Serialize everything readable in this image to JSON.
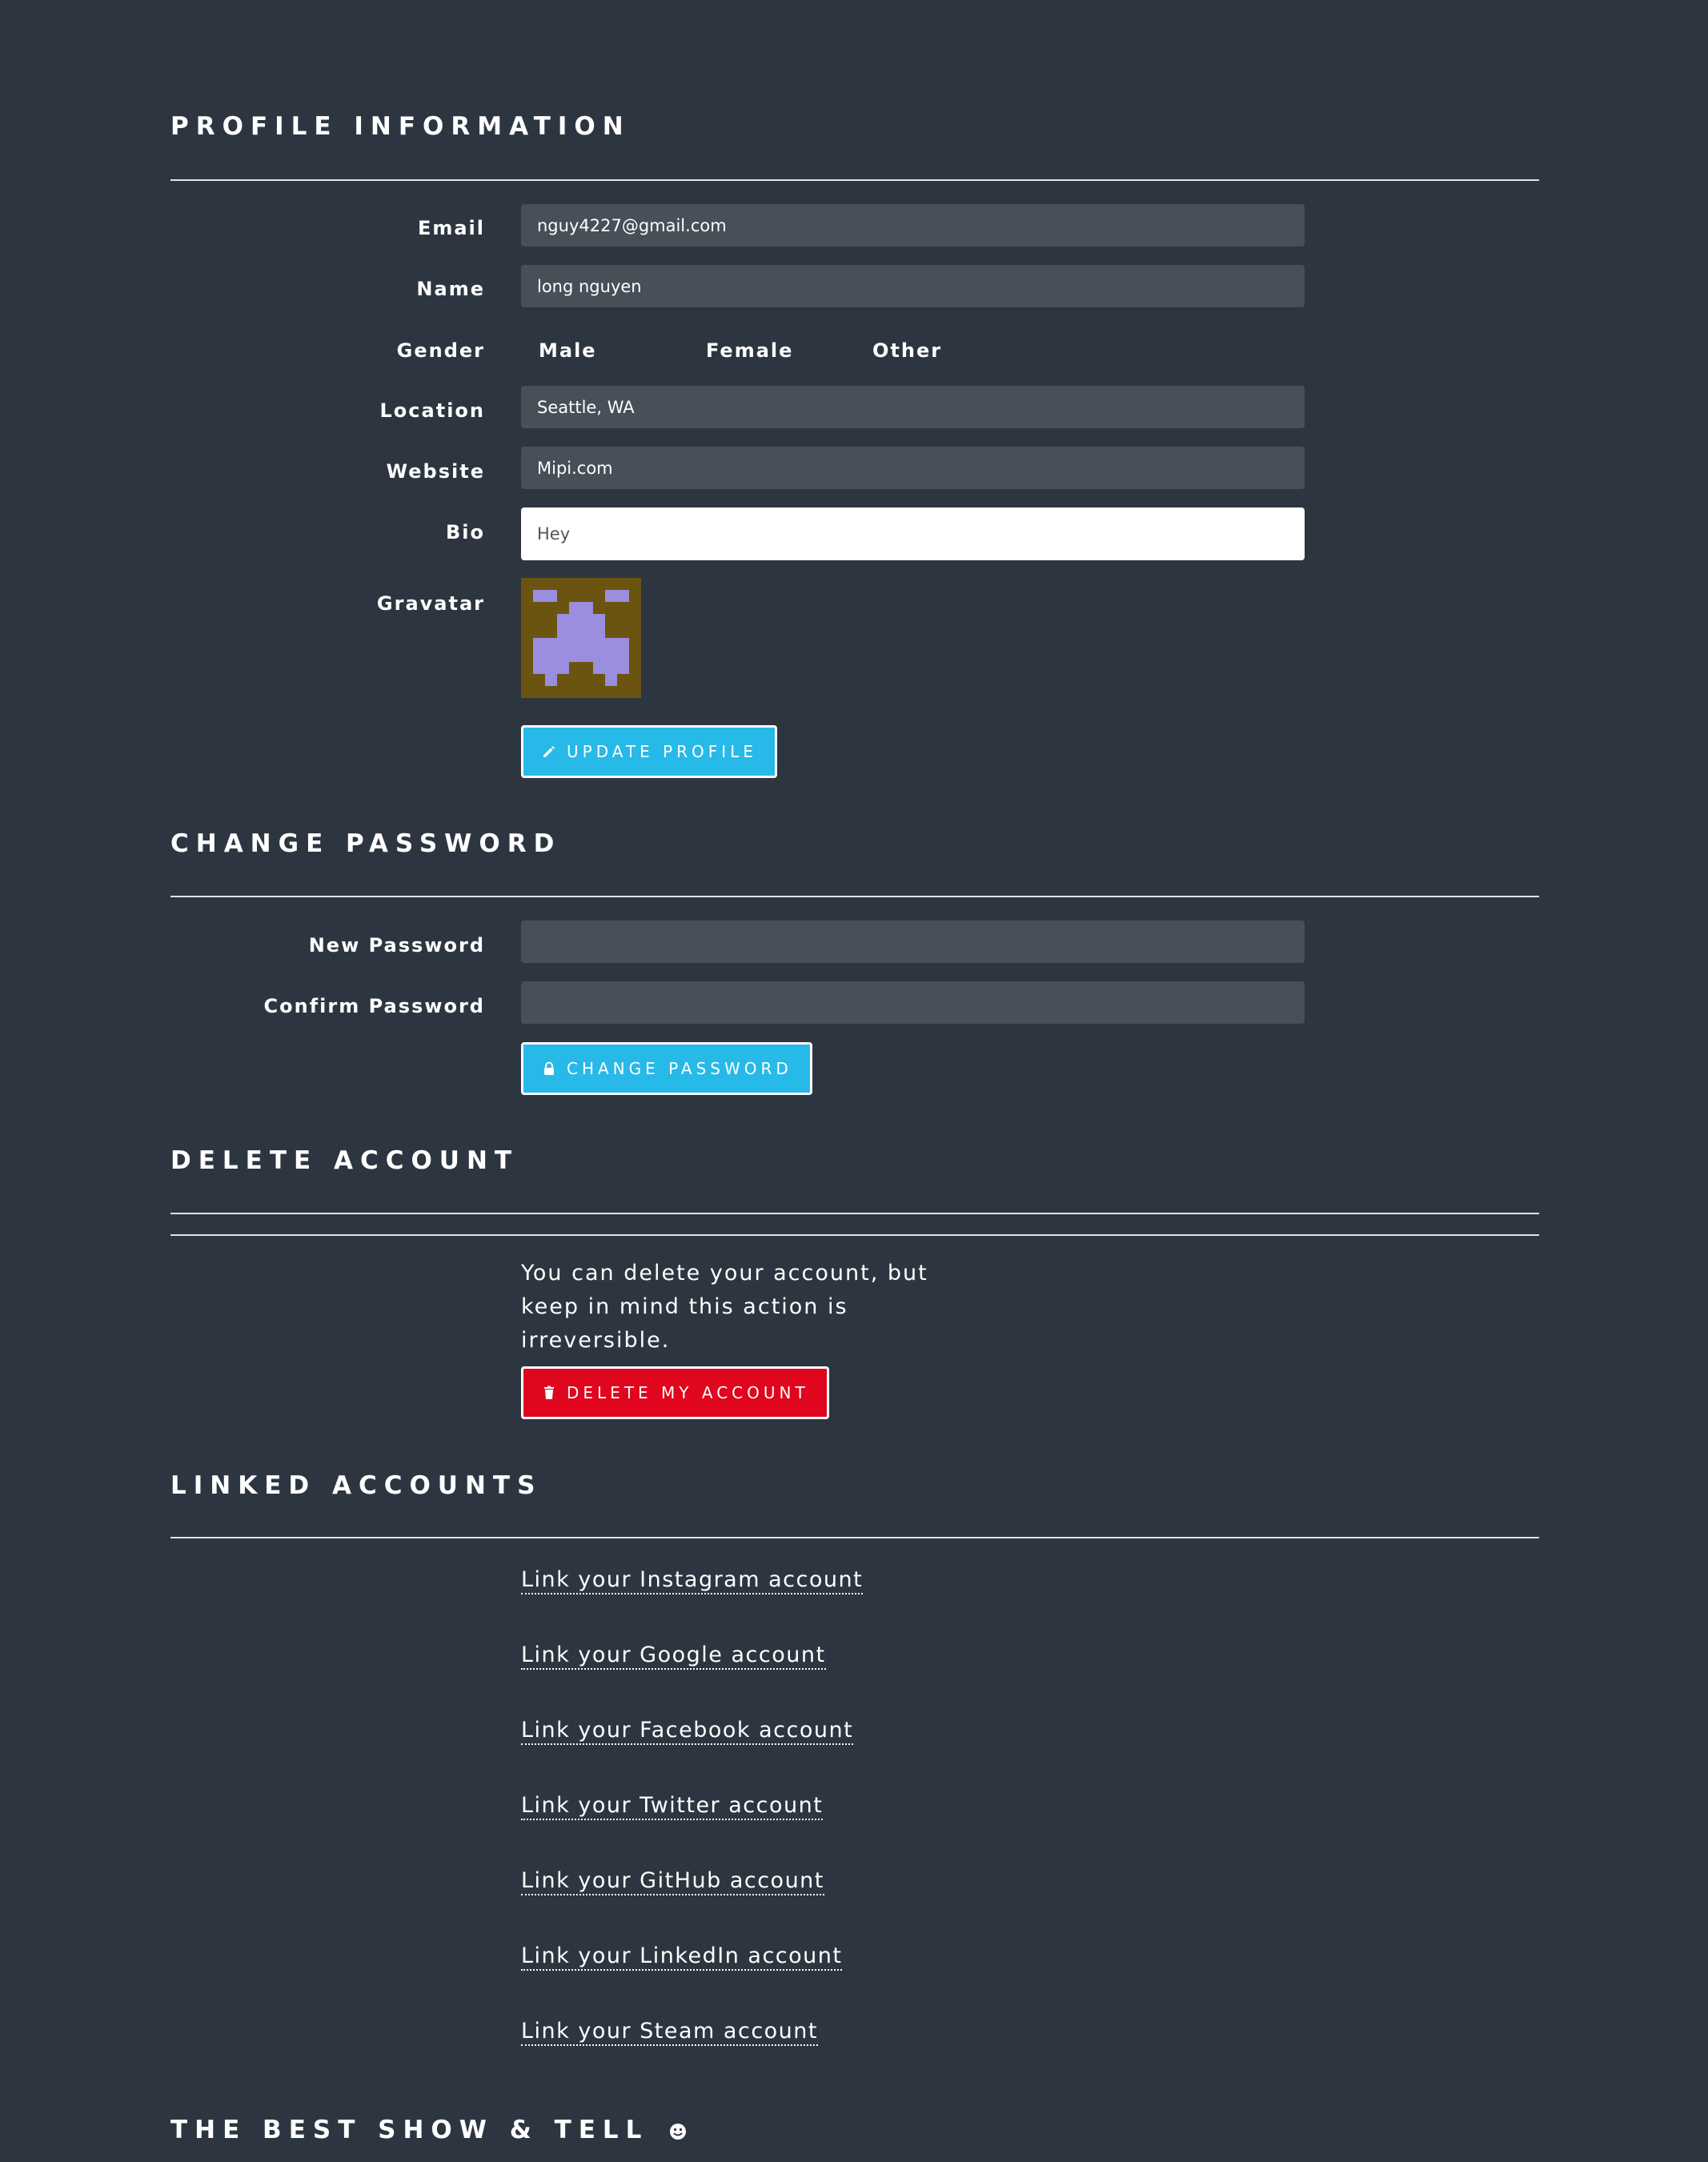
{
  "profile": {
    "title": "PROFILE INFORMATION",
    "email_label": "Email",
    "email_value": "nguy4227@gmail.com",
    "name_label": "Name",
    "name_value": "long nguyen",
    "gender_label": "Gender",
    "gender_options": [
      "Male",
      "Female",
      "Other"
    ],
    "location_label": "Location",
    "location_value": "Seattle, WA",
    "website_label": "Website",
    "website_value": "Mipi.com",
    "bio_label": "Bio",
    "bio_value": "Hey",
    "gravatar_label": "Gravatar",
    "update_button": "UPDATE PROFILE"
  },
  "password": {
    "title": "CHANGE PASSWORD",
    "new_label": "New Password",
    "confirm_label": "Confirm Password",
    "change_button": "CHANGE PASSWORD"
  },
  "delete": {
    "title": "DELETE ACCOUNT",
    "warning": "You can delete your account, but keep in mind this action is irreversible.",
    "delete_button": "DELETE MY ACCOUNT"
  },
  "linked": {
    "title": "LINKED ACCOUNTS",
    "links": [
      "Link your Instagram account",
      "Link your Google account",
      "Link your Facebook account",
      "Link your Twitter account",
      "Link your GitHub account",
      "Link your LinkedIn account",
      "Link your Steam account"
    ]
  },
  "footer": {
    "title": "THE BEST SHOW & TELL"
  },
  "colors": {
    "background": "#2d3640",
    "input": "#474f58",
    "primary_button": "#27b9e8",
    "danger_button": "#e0061e",
    "gravatar_bg": "#6b5310",
    "gravatar_fg": "#9a8fde"
  },
  "icons": {
    "update": "pencil-icon",
    "change": "lock-icon",
    "delete": "trash-icon",
    "footer": "smiley-icon"
  }
}
